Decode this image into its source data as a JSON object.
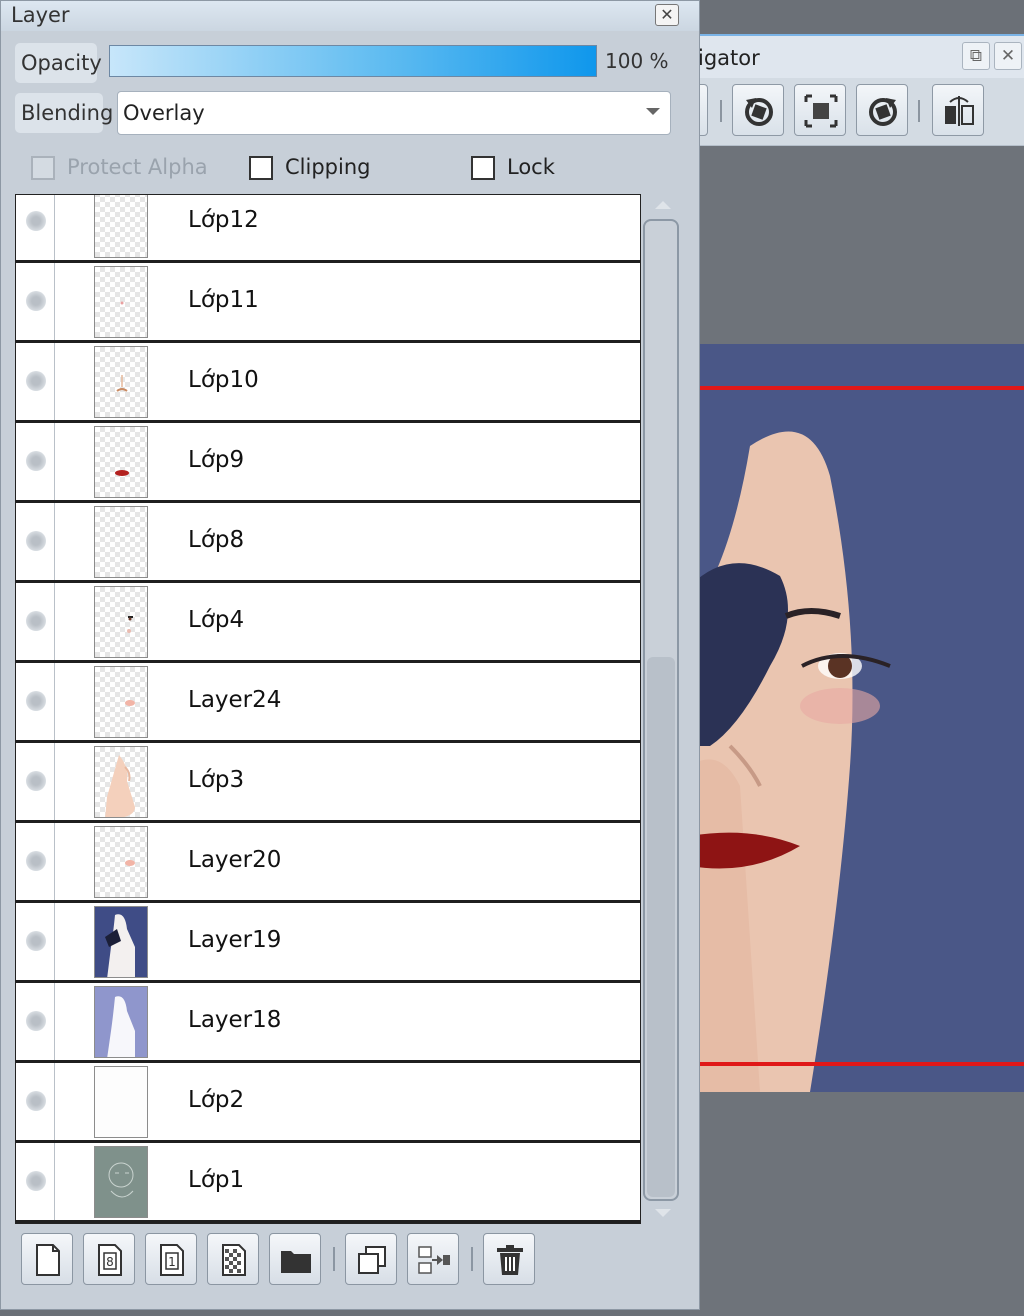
{
  "layer_panel": {
    "title": "Layer",
    "opacity": {
      "label": "Opacity",
      "value_text": "100 %",
      "value": 100
    },
    "blending": {
      "label": "Blending",
      "value": "Overlay"
    },
    "options": {
      "protect_alpha": "Protect Alpha",
      "clipping": "Clipping",
      "lock": "Lock"
    },
    "layers": [
      {
        "name": "Lớp12",
        "thumb": "empty"
      },
      {
        "name": "Lớp11",
        "thumb": "dot"
      },
      {
        "name": "Lớp10",
        "thumb": "mouth-small"
      },
      {
        "name": "Lớp9",
        "thumb": "lips"
      },
      {
        "name": "Lớp8",
        "thumb": "empty"
      },
      {
        "name": "Lớp4",
        "thumb": "eye"
      },
      {
        "name": "Layer24",
        "thumb": "blush"
      },
      {
        "name": "Lớp3",
        "thumb": "skin"
      },
      {
        "name": "Layer20",
        "thumb": "blush"
      },
      {
        "name": "Layer19",
        "thumb": "hair-dark"
      },
      {
        "name": "Layer18",
        "thumb": "hair-light"
      },
      {
        "name": "Lớp2",
        "thumb": "white"
      },
      {
        "name": "Lớp1",
        "thumb": "sketch"
      }
    ],
    "toolbar_icons": [
      "new-layer-icon",
      "new-8bit-layer-icon",
      "new-1bit-layer-icon",
      "new-halftone-layer-icon",
      "new-folder-icon",
      "duplicate-layer-icon",
      "merge-down-icon",
      "delete-layer-icon"
    ]
  },
  "navigator": {
    "title": "igator",
    "tool_icons": [
      "partial-tool-icon",
      "rotate-left-icon",
      "fit-screen-icon",
      "rotate-right-icon",
      "flip-horizontal-icon"
    ]
  },
  "colors": {
    "panel_bg": "#c7cfd8",
    "opacity_bar_start": "#c7e6fa",
    "opacity_bar_end": "#0f97ec",
    "hair": "#4a5787",
    "skin": "#eac5b0",
    "lips": "#8e1414",
    "guide_line": "#e01818",
    "canvas_gray": "#6e737a"
  }
}
